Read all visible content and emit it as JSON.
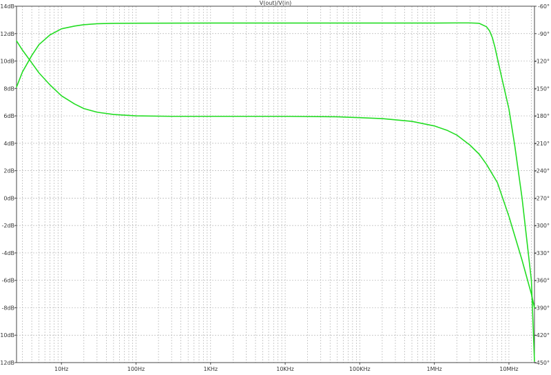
{
  "chart_data": {
    "type": "line",
    "title": "V(out)/V(in)",
    "x_scale": "log",
    "xlim": [
      2.5,
      22000000
    ],
    "x_ticks": [
      {
        "value": 10,
        "label": "10Hz"
      },
      {
        "value": 100,
        "label": "100Hz"
      },
      {
        "value": 1000,
        "label": "1KHz"
      },
      {
        "value": 10000,
        "label": "10KHz"
      },
      {
        "value": 100000,
        "label": "100KHz"
      },
      {
        "value": 1000000,
        "label": "1MHz"
      },
      {
        "value": 10000000,
        "label": "10MHz"
      }
    ],
    "y_left": {
      "ylim": [
        -12,
        14
      ],
      "ticks": [
        "14dB",
        "12dB",
        "10dB",
        "8dB",
        "6dB",
        "4dB",
        "2dB",
        "0dB",
        "-2dB",
        "-4dB",
        "-6dB",
        "-8dB",
        "-10dB",
        "-12dB"
      ],
      "tick_values": [
        14,
        12,
        10,
        8,
        6,
        4,
        2,
        0,
        -2,
        -4,
        -6,
        -8,
        -10,
        -12
      ]
    },
    "y_right": {
      "ylim": [
        -450,
        -60
      ],
      "ticks": [
        "-60°",
        "-90°",
        "-120°",
        "-150°",
        "-180°",
        "-210°",
        "-240°",
        "-270°",
        "-300°",
        "-330°",
        "-360°",
        "-390°",
        "-420°",
        "-450°"
      ],
      "tick_values": [
        -60,
        -90,
        -120,
        -150,
        -180,
        -210,
        -240,
        -270,
        -300,
        -330,
        -360,
        -390,
        -420,
        -450
      ]
    },
    "grid": true,
    "trace_color": "#22dd22",
    "series": [
      {
        "axis": "left",
        "unit": "dB",
        "x": [
          2.5,
          3,
          4,
          5,
          7,
          10,
          15,
          20,
          30,
          50,
          100,
          1000,
          100000,
          1000000,
          2000000,
          3000000,
          4000000,
          5000000,
          5500000,
          6000000,
          6500000,
          7000000,
          8000000,
          10000000,
          12000000,
          15000000,
          20000000,
          22000000
        ],
        "y": [
          8.1,
          9.2,
          10.4,
          11.2,
          11.9,
          12.35,
          12.55,
          12.65,
          12.72,
          12.75,
          12.76,
          12.77,
          12.77,
          12.77,
          12.78,
          12.78,
          12.75,
          12.5,
          12.2,
          11.7,
          11.0,
          10.2,
          8.8,
          6.5,
          3.8,
          0.0,
          -6.0,
          -11.9
        ]
      },
      {
        "axis": "right",
        "unit": "deg",
        "x": [
          2.5,
          3,
          4,
          5,
          7,
          10,
          15,
          20,
          30,
          50,
          100,
          300,
          1000,
          10000,
          50000,
          100000,
          200000,
          500000,
          1000000,
          1500000,
          2000000,
          3000000,
          4000000,
          5000000,
          7000000,
          10000000,
          15000000,
          20000000,
          22000000
        ],
        "y": [
          -98,
          -108,
          -122,
          -133,
          -146,
          -158,
          -167,
          -172,
          -176,
          -178.5,
          -180,
          -180.5,
          -180.5,
          -180.5,
          -181,
          -182,
          -183,
          -186,
          -191,
          -196,
          -201,
          -212,
          -222,
          -233,
          -253,
          -290,
          -338,
          -375,
          -390
        ]
      }
    ]
  }
}
